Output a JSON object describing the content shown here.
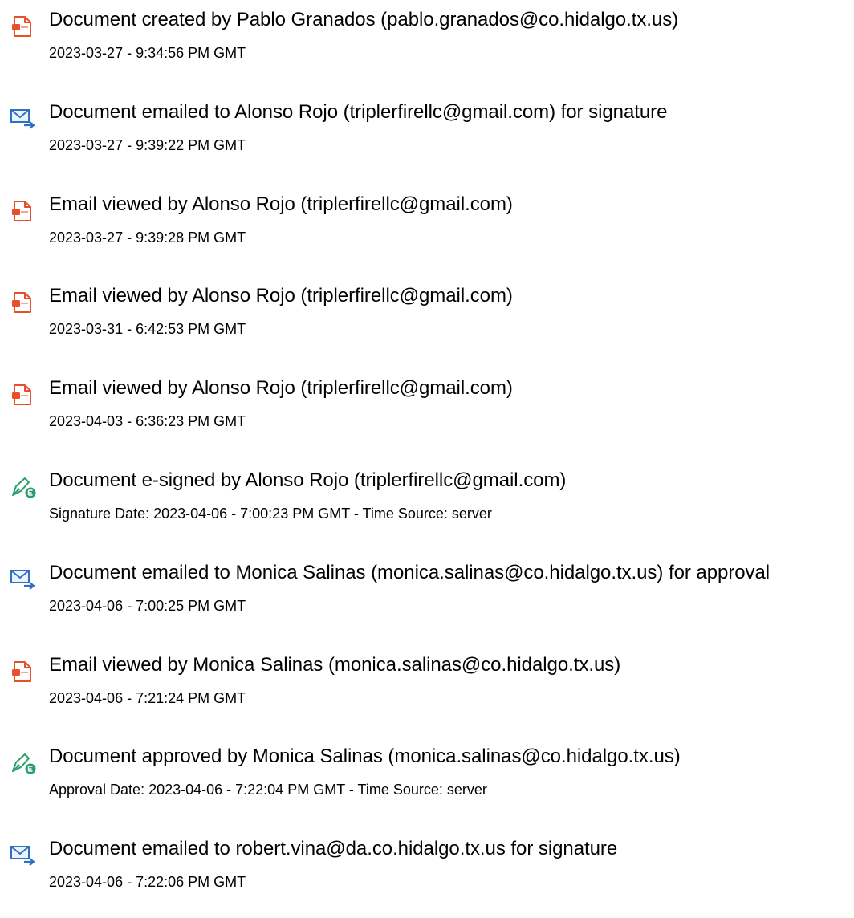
{
  "entries": [
    {
      "icon": "document-created-icon",
      "title": "Document created by Pablo Granados (pablo.granados@co.hidalgo.tx.us)",
      "date": "2023-03-27 - 9:34:56 PM GMT"
    },
    {
      "icon": "email-sent-icon",
      "title": "Document emailed to Alonso Rojo (triplerfirellc@gmail.com) for signature",
      "date": "2023-03-27 - 9:39:22 PM GMT"
    },
    {
      "icon": "document-viewed-icon",
      "title": "Email viewed by Alonso Rojo (triplerfirellc@gmail.com)",
      "date": "2023-03-27 - 9:39:28 PM GMT"
    },
    {
      "icon": "document-viewed-icon",
      "title": "Email viewed by Alonso Rojo (triplerfirellc@gmail.com)",
      "date": "2023-03-31 - 6:42:53 PM GMT"
    },
    {
      "icon": "document-viewed-icon",
      "title": "Email viewed by Alonso Rojo (triplerfirellc@gmail.com)",
      "date": "2023-04-03 - 6:36:23 PM GMT"
    },
    {
      "icon": "pen-signed-icon",
      "title": "Document e-signed by Alonso Rojo (triplerfirellc@gmail.com)",
      "date": "Signature Date: 2023-04-06 - 7:00:23 PM GMT - Time Source: server"
    },
    {
      "icon": "email-sent-icon",
      "title": "Document emailed to Monica Salinas (monica.salinas@co.hidalgo.tx.us) for approval",
      "date": "2023-04-06 - 7:00:25 PM GMT"
    },
    {
      "icon": "document-viewed-icon",
      "title": "Email viewed by Monica Salinas (monica.salinas@co.hidalgo.tx.us)",
      "date": "2023-04-06 - 7:21:24 PM GMT"
    },
    {
      "icon": "pen-signed-icon",
      "title": "Document approved by Monica Salinas (monica.salinas@co.hidalgo.tx.us)",
      "date": "Approval Date: 2023-04-06 - 7:22:04 PM GMT - Time Source: server"
    },
    {
      "icon": "email-sent-icon",
      "title": "Document emailed to robert.vina@da.co.hidalgo.tx.us for signature",
      "date": "2023-04-06 - 7:22:06 PM GMT"
    }
  ],
  "colors": {
    "document_icon": "#e8502a",
    "email_icon": "#2f6fc4",
    "pen_icon": "#2a9d6a",
    "text": "#000000"
  }
}
